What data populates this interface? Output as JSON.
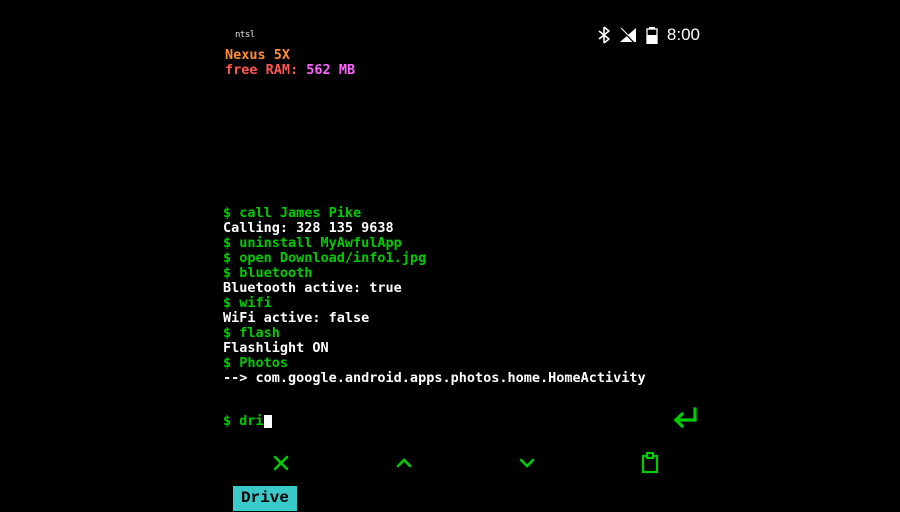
{
  "status": {
    "left_label": "ntsl",
    "clock": "8:00"
  },
  "header": {
    "device": "Nexus 5X",
    "ram_label": "free RAM:",
    "ram_value": "562",
    "ram_unit": "MB"
  },
  "lines": [
    {
      "kind": "cmd",
      "text": "$ call James Pike"
    },
    {
      "kind": "out",
      "text": "Calling: 328 135 9638"
    },
    {
      "kind": "cmd",
      "text": "$ uninstall MyAwfulApp"
    },
    {
      "kind": "cmd",
      "text": "$ open Download/info1.jpg"
    },
    {
      "kind": "cmd",
      "text": "$ bluetooth"
    },
    {
      "kind": "out",
      "text": "Bluetooth active: true"
    },
    {
      "kind": "cmd",
      "text": "$ wifi"
    },
    {
      "kind": "out",
      "text": "WiFi active: false"
    },
    {
      "kind": "cmd",
      "text": "$ flash"
    },
    {
      "kind": "out",
      "text": "Flashlight ON"
    },
    {
      "kind": "cmd",
      "text": "$ Photos"
    },
    {
      "kind": "out",
      "text": "--> com.google.android.apps.photos.home.HomeActivity"
    }
  ],
  "input": {
    "prompt": "$",
    "typed": "dri"
  },
  "suggestion": "Drive",
  "colors": {
    "cmd": "#00cc00",
    "out": "#ffffff",
    "device": "#ff8c3a",
    "ram_label": "#ff5555",
    "ram_value": "#ff66ff",
    "accent": "#39c9c9"
  }
}
